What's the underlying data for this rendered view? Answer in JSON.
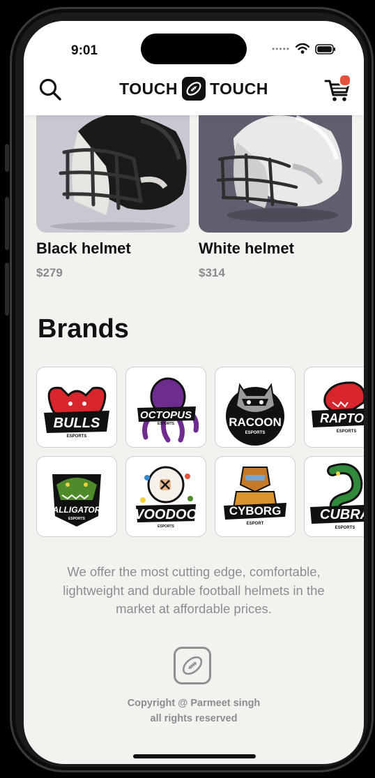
{
  "status_bar": {
    "time": "9:01"
  },
  "header": {
    "logo_left": "TOUCH",
    "logo_right": "TOUCH"
  },
  "products": [
    {
      "name": "Black helmet",
      "price": "$279",
      "bg": "#c9c7d1"
    },
    {
      "name": "White helmet",
      "price": "$314",
      "bg": "#5f5f70"
    }
  ],
  "brands_title": "Brands",
  "brands": [
    {
      "label": "BULLS",
      "sub": "ESPORTS",
      "color": "#d8262c",
      "icon": "bull-icon"
    },
    {
      "label": "OCTOPUS",
      "sub": "ESPORTS",
      "color": "#6e2c8f",
      "icon": "octopus-icon"
    },
    {
      "label": "RACOON",
      "sub": "ESPORTS",
      "color": "#555555",
      "icon": "racoon-icon"
    },
    {
      "label": "RAPTOR",
      "sub": "ESPORTS",
      "color": "#d8262c",
      "icon": "raptor-icon"
    },
    {
      "label": "ALLIGATOR",
      "sub": "ESPORTS",
      "color": "#4f8a2b",
      "icon": "alligator-icon"
    },
    {
      "label": "VOODOO",
      "sub": "ESPORTS",
      "color": "#e8b48c",
      "icon": "voodoo-icon"
    },
    {
      "label": "CYBORG",
      "sub": "ESPORT",
      "color": "#c67a28",
      "icon": "cyborg-icon"
    },
    {
      "label": "CUBRA",
      "sub": "ESPORTS",
      "color": "#2f8a3c",
      "icon": "cobra-icon"
    }
  ],
  "footer": {
    "description": "We offer the most cutting edge, comfortable, lightweight and durable football helmets in the market at affordable prices.",
    "copyright_line1": "Copyright @ Parmeet singh",
    "copyright_line2": "all rights reserved"
  },
  "colors": {
    "accent": "#e5533c",
    "background": "#f3f2ee",
    "muted_text": "#8d8d8d"
  }
}
